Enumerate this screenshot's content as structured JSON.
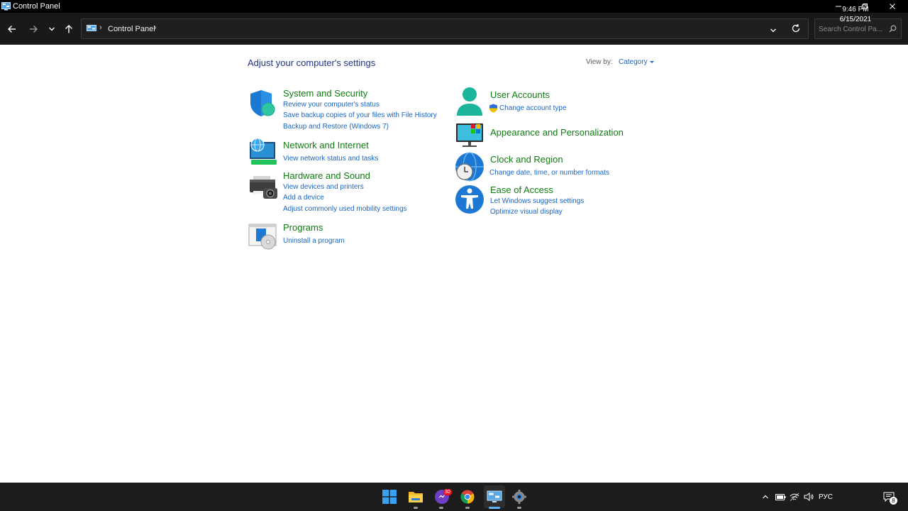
{
  "window": {
    "title": "Control Panel"
  },
  "address_bar": {
    "breadcrumb": "Control Panel",
    "search_placeholder": "Search Control Pa..."
  },
  "page": {
    "heading": "Adjust your computer's settings",
    "view_by_label": "View by:",
    "view_by_value": "Category"
  },
  "categories": {
    "system_security": {
      "title": "System and Security",
      "links": [
        "Review your computer's status",
        "Save backup copies of your files with File History",
        "Backup and Restore (Windows 7)"
      ]
    },
    "network_internet": {
      "title": "Network and Internet",
      "links": [
        "View network status and tasks"
      ]
    },
    "hardware_sound": {
      "title": "Hardware and Sound",
      "links": [
        "View devices and printers",
        "Add a device",
        "Adjust commonly used mobility settings"
      ]
    },
    "programs": {
      "title": "Programs",
      "links": [
        "Uninstall a program"
      ]
    },
    "user_accounts": {
      "title": "User Accounts",
      "links": [
        "Change account type"
      ]
    },
    "appearance": {
      "title": "Appearance and Personalization",
      "links": []
    },
    "clock_region": {
      "title": "Clock and Region",
      "links": [
        "Change date, time, or number formats"
      ]
    },
    "ease_of_access": {
      "title": "Ease of Access",
      "links": [
        "Let Windows suggest settings",
        "Optimize visual display"
      ]
    }
  },
  "taskbar": {
    "apps": [
      "start",
      "file-explorer",
      "messenger",
      "chrome",
      "control-panel",
      "settings"
    ],
    "messenger_badge": "30",
    "language": "РУС",
    "time": "9:46 PM",
    "date": "6/15/2021",
    "notification_count": "8"
  },
  "colors": {
    "category_title": "#107c10",
    "link": "#1a66c6",
    "heading": "#1e3287",
    "titlebar": "#000000",
    "navbar": "#191919",
    "taskbar": "#1c1c1c"
  }
}
